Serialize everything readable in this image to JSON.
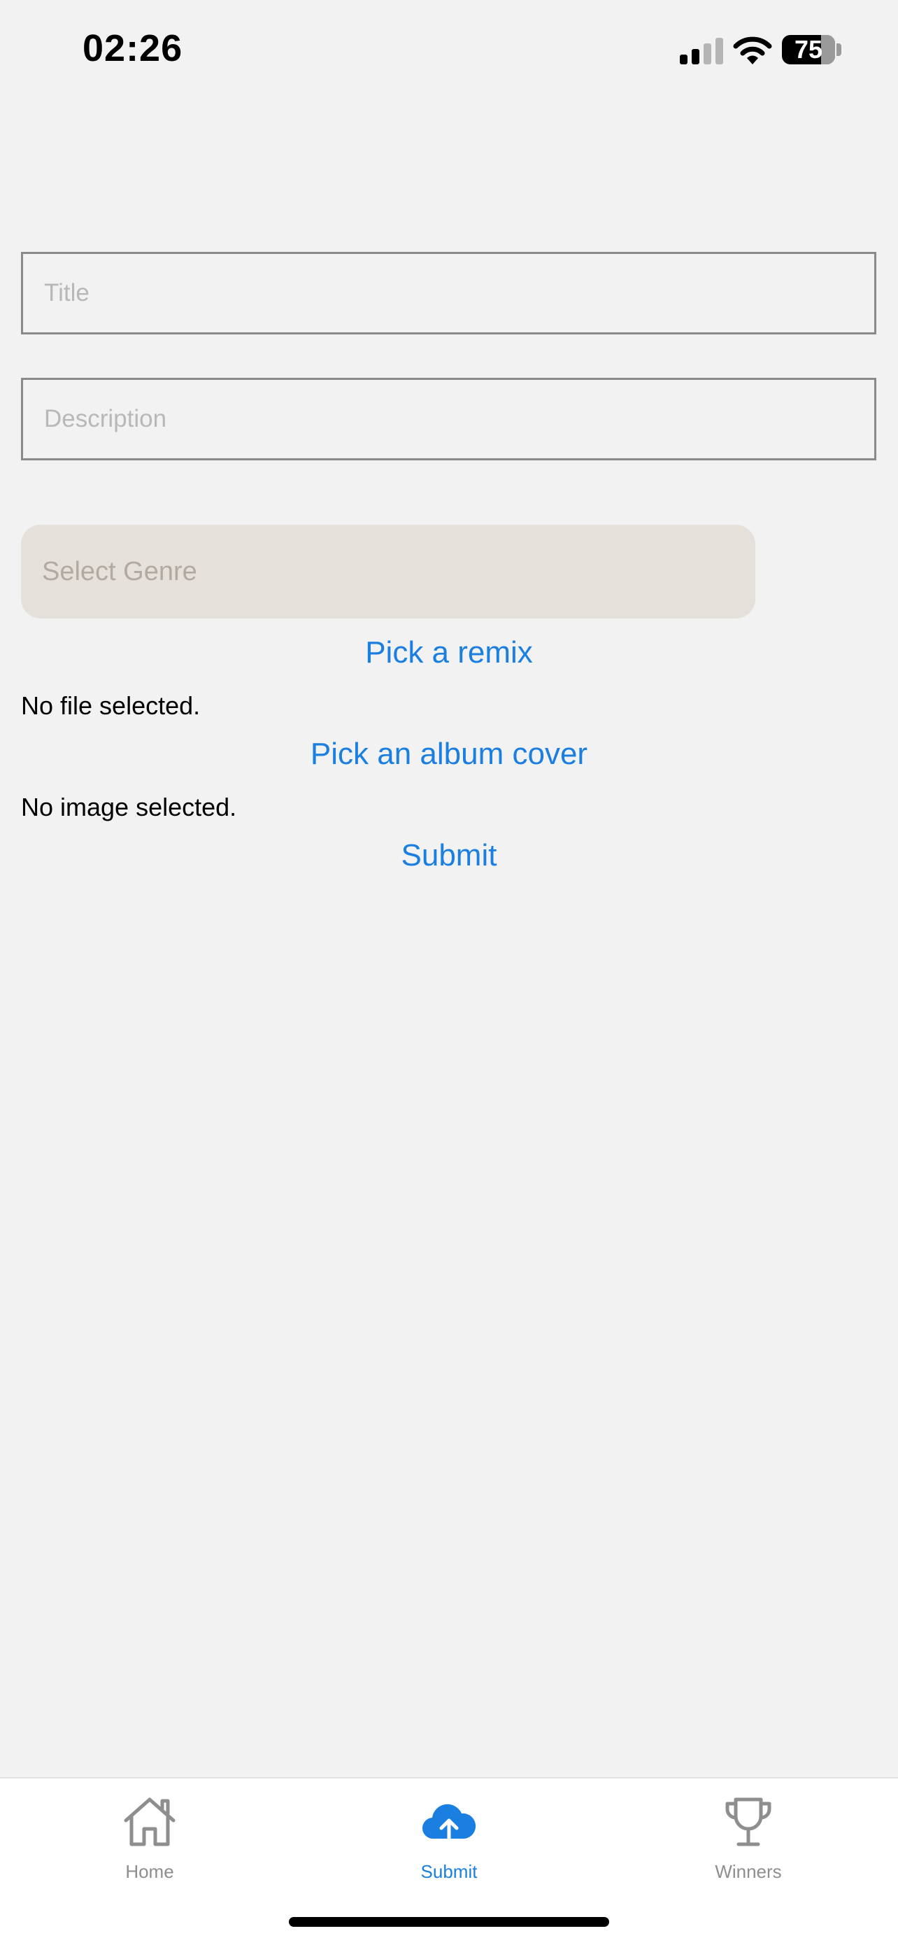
{
  "status_bar": {
    "time": "02:26",
    "battery": "75",
    "signal_icon": "cellular-signal-icon",
    "wifi_icon": "wifi-icon"
  },
  "form": {
    "title_placeholder": "Title",
    "title_value": "",
    "description_placeholder": "Description",
    "description_value": "",
    "genre_label": "Select Genre",
    "pick_remix_label": "Pick a remix",
    "file_status": "No file selected.",
    "pick_cover_label": "Pick an album cover",
    "image_status": "No image selected.",
    "submit_label": "Submit"
  },
  "tab_bar": {
    "tabs": [
      {
        "label": "Home",
        "icon": "home-icon",
        "active": false
      },
      {
        "label": "Submit",
        "icon": "cloud-upload-icon",
        "active": true
      },
      {
        "label": "Winners",
        "icon": "trophy-icon",
        "active": false
      }
    ]
  },
  "colors": {
    "accent": "#1a7fe0",
    "background": "#f2f2f2",
    "inactive_tab": "#8e8e8e",
    "genre_select_bg": "#e5e0d9"
  }
}
